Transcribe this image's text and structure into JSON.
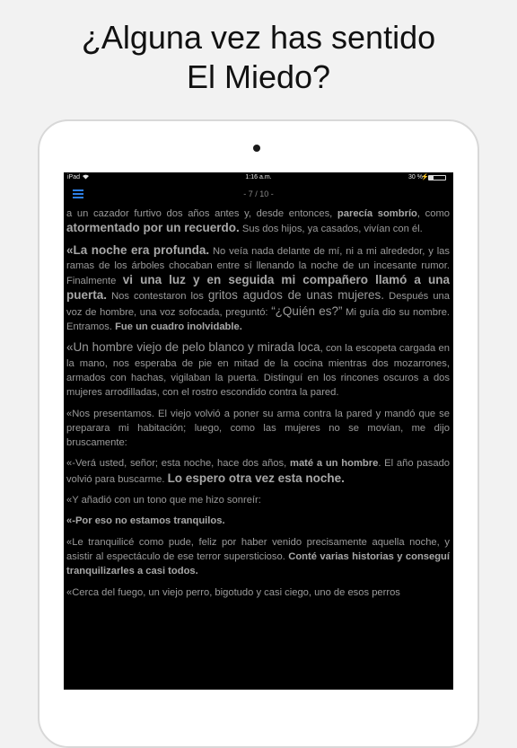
{
  "headline": {
    "line1": "¿Alguna vez has sentido",
    "line2": "El Miedo?"
  },
  "status": {
    "device": "iPad",
    "time": "1:16 a.m.",
    "battery": "30 %",
    "battery_level": 0.3
  },
  "toolbar": {
    "page": "- 7 / 10 -"
  },
  "icons": {
    "menu": "hamburger-menu-icon",
    "wifi": "wifi-icon",
    "battery": "battery-icon"
  },
  "colors": {
    "accent": "#2d7fe6",
    "screen": "#000000",
    "text": "#9a9a9a"
  },
  "story": {
    "p1": [
      "a un cazador furtivo dos años antes y, desde entonces, ",
      "parecía sombrío",
      ", como ",
      "atormentado por un recuerdo.",
      " Sus dos hijos, ya casados, vivían con él."
    ],
    "p2": [
      "«La noche era profunda.",
      " No veía nada delante de mí, ni a mi alrededor, y las ramas de los árboles chocaban entre sí llenando la noche de un incesante rumor. Finalmente ",
      "vi una luz y en seguida mi compañero llamó a una puerta.",
      " Nos contestaron los ",
      "gritos agudos de unas mujeres.",
      " Después una voz de hombre, una voz sofocada, preguntó: ",
      "“¿Quién es?”",
      " Mi guía dio su nombre. Entramos. ",
      "Fue un cuadro inolvidable."
    ],
    "p3": [
      "«Un hombre viejo de pelo blanco y mirada loca",
      ", con la escopeta cargada en la mano, nos esperaba de pie en mitad de la cocina mientras dos mozarrones, armados con hachas, vigilaban la puerta. Distinguí en los rincones oscuros a dos mujeres arrodilladas, con el rostro escondido contra la pared."
    ],
    "p4": "«Nos presentamos. El viejo volvió a poner su arma contra la pared y mandó que se preparara mi habitación; luego, como las mujeres no se movían, me dijo bruscamente:",
    "p5": [
      "«-Verá usted, señor; esta noche, hace dos años, ",
      "maté a un hombre",
      ". El año pasado volvió para buscarme. ",
      "Lo espero otra vez esta noche."
    ],
    "p6": "«Y añadió con un tono que me hizo sonreír:",
    "p7": "«-Por eso no estamos tranquilos.",
    "p8": [
      "«Le tranquilicé como pude, feliz por haber venido precisamente aquella noche, y asistir al espectáculo de ese terror supersticioso. ",
      "Conté varias historias y conseguí tranquilizarles a casi todos."
    ],
    "p9": "«Cerca del fuego, un viejo perro, bigotudo y casi ciego, uno de esos perros"
  }
}
